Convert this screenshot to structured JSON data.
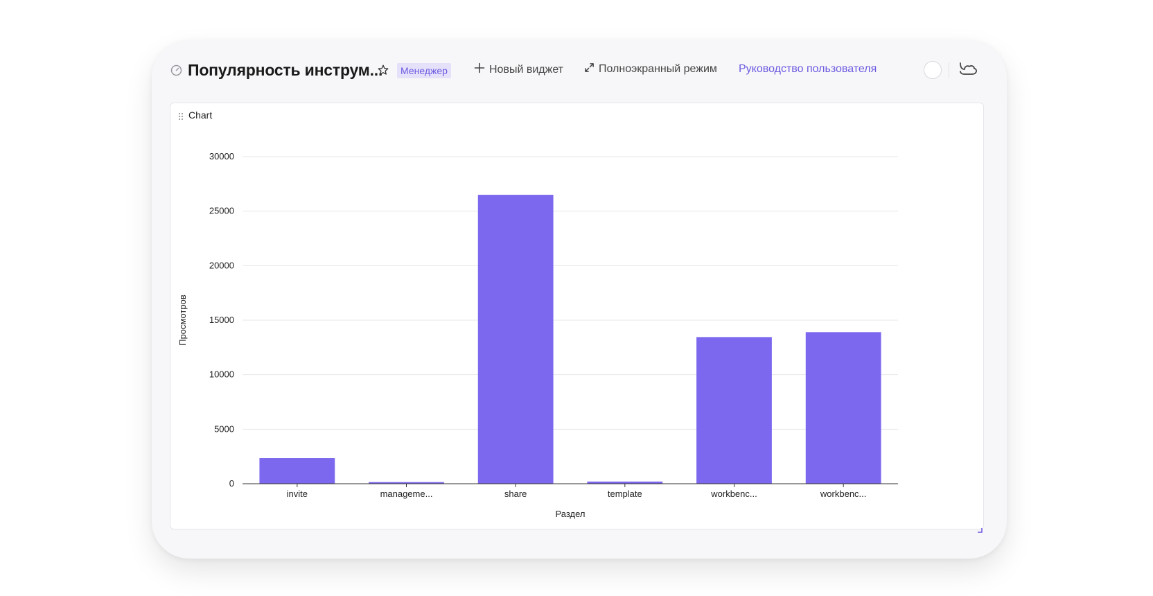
{
  "header": {
    "title": "Популярность инструм...",
    "badge": "Менеджер",
    "new_widget_label": "Новый виджет",
    "fullscreen_label": "Полноэкранный режим",
    "guide_link": "Руководство пользователя"
  },
  "widget": {
    "title": "Chart"
  },
  "colors": {
    "accent": "#6b5ae0",
    "bar": "#7b68ee",
    "badge_bg": "#e6e1fb"
  },
  "chart_data": {
    "type": "bar",
    "title": "Chart",
    "categories": [
      "invite",
      "manageme...",
      "share",
      "template",
      "workbenc...",
      "workbenc..."
    ],
    "values": [
      2350,
      150,
      26500,
      200,
      13450,
      13900
    ],
    "xlabel": "Раздел",
    "ylabel": "Просмотров",
    "ylim": [
      0,
      30000
    ],
    "yticks": [
      0,
      5000,
      10000,
      15000,
      20000,
      25000,
      30000
    ],
    "grid": true,
    "legend": "none"
  }
}
